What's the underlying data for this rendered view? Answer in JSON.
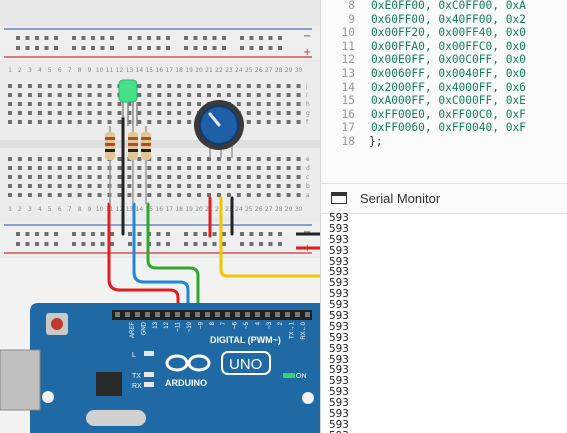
{
  "editor": {
    "lines": [
      {
        "num": "8",
        "code": "0xE0FF00, 0xC0FF00, 0xA"
      },
      {
        "num": "9",
        "code": "0x60FF00, 0x40FF00, 0x2"
      },
      {
        "num": "10",
        "code": "0x00FF20, 0x00FF40, 0x0"
      },
      {
        "num": "11",
        "code": "0x00FFA0, 0x00FFC0, 0x0"
      },
      {
        "num": "12",
        "code": "0x00E0FF, 0x00C0FF, 0x0"
      },
      {
        "num": "13",
        "code": "0x0060FF, 0x0040FF, 0x0"
      },
      {
        "num": "14",
        "code": "0x2000FF, 0x4000FF, 0x6"
      },
      {
        "num": "15",
        "code": "0xA000FF, 0xC000FF, 0xE"
      },
      {
        "num": "16",
        "code": "0xFF00E0, 0xFF00C0, 0xF"
      },
      {
        "num": "17",
        "code": "0xFF0060, 0xFF0040, 0xF"
      },
      {
        "num": "18",
        "code": "};"
      }
    ]
  },
  "serial_monitor": {
    "title": "Serial Monitor",
    "icon": "serial-monitor-icon",
    "output": [
      "593",
      "593",
      "593",
      "593",
      "593",
      "593",
      "593",
      "593",
      "593",
      "593",
      "593",
      "593",
      "593",
      "593",
      "593",
      "593",
      "593",
      "593",
      "593",
      "593",
      "593"
    ]
  },
  "breadboard": {
    "column_numbers": [
      "1",
      "2",
      "3",
      "4",
      "5",
      "6",
      "7",
      "8",
      "9",
      "10",
      "11",
      "12",
      "13",
      "14",
      "15",
      "16",
      "17",
      "18",
      "19",
      "20",
      "21",
      "22",
      "23",
      "24",
      "25",
      "26",
      "27",
      "28",
      "29",
      "30"
    ],
    "row_letters_top": [
      "j",
      "i",
      "h",
      "g",
      "f"
    ],
    "row_letters_bottom": [
      "e",
      "d",
      "c",
      "b",
      "a"
    ]
  },
  "arduino": {
    "brand": "ARDUINO",
    "model": "UNO",
    "digital_label": "DIGITAL (PWM~)",
    "on_label": "ON",
    "l_label": "L",
    "tx_label": "TX",
    "rx_label": "RX",
    "header_labels": [
      "AREF",
      "GND",
      "13",
      "12",
      "~11",
      "~10",
      "~9",
      "8",
      "7",
      "~6",
      "~5",
      "4",
      "~3",
      "2",
      "TX→1",
      "RX←0"
    ]
  },
  "colors": {
    "board": "#1f6aa5",
    "wire_red": "#e01e1e",
    "wire_blue": "#1e88d8",
    "wire_green": "#2ea82e",
    "wire_yellow": "#f2c500",
    "led": "#44e08a",
    "code_text": "#12805c"
  }
}
